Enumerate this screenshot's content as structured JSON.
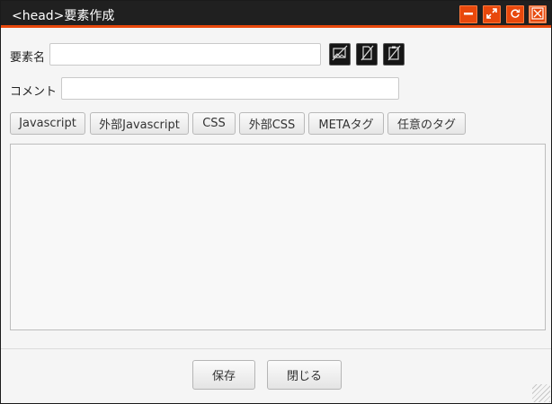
{
  "window": {
    "title": "<head>要素作成",
    "controls": {
      "minimize_icon": "minimize-icon",
      "maximize_icon": "maximize-icon",
      "refresh_icon": "refresh-icon",
      "close_icon": "close-icon"
    },
    "accent_color": "#e8480c",
    "titlebar_color": "#202020"
  },
  "form": {
    "element_name_label": "要素名",
    "element_name_value": "",
    "comment_label": "コメント",
    "comment_value": "",
    "icon_buttons": [
      "image-off-icon",
      "doc-off-icon",
      "clipboard-off-icon"
    ],
    "tag_buttons": [
      "Javascript",
      "外部Javascript",
      "CSS",
      "外部CSS",
      "METAタグ",
      "任意のタグ"
    ],
    "content_value": ""
  },
  "footer": {
    "save_label": "保存",
    "close_label": "閉じる"
  }
}
